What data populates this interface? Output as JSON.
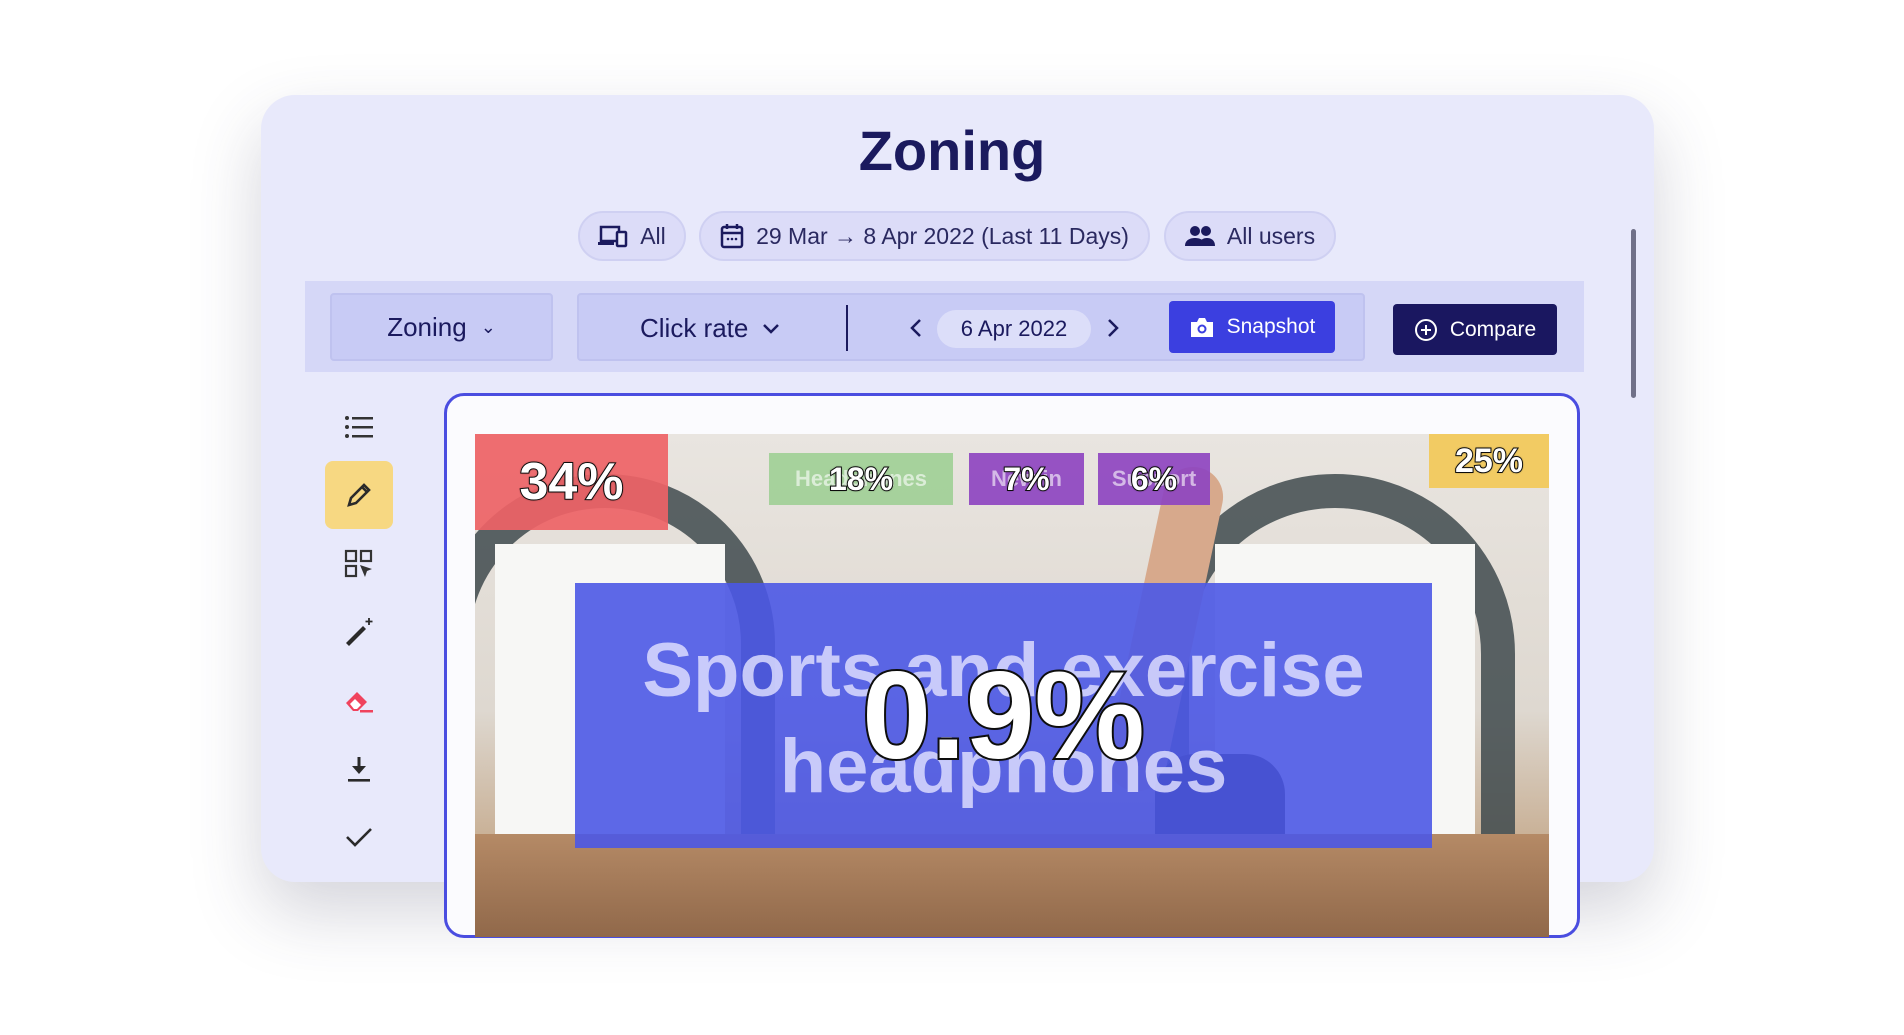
{
  "title": "Zoning",
  "filters": {
    "device": "All",
    "date_range": "29 Mar → 8 Apr 2022 (Last 11 Days)",
    "users": "All users"
  },
  "toolbar": {
    "view": "Zoning",
    "metric": "Click rate",
    "date": "6 Apr 2022",
    "snapshot": "Snapshot",
    "compare": "Compare"
  },
  "sidebar": [
    "list-icon",
    "pencil-icon",
    "zone-select-icon",
    "magic-wand-icon",
    "eraser-icon",
    "download-icon",
    "check-icon"
  ],
  "sidebar_active": "pencil-icon",
  "zones": [
    {
      "label": "",
      "value": "34%",
      "color": "#ee6a6c"
    },
    {
      "label": "Headphones",
      "value": "18%",
      "color": "#9fcf95"
    },
    {
      "label": "New in",
      "value": "7%",
      "color": "#8e45c0"
    },
    {
      "label": "Support",
      "value": "6%",
      "color": "#8e45c0"
    },
    {
      "label": "",
      "value": "25%",
      "color": "#f2c95c"
    },
    {
      "label": "Sports and exercise headphones",
      "value": "0.9%",
      "color": "#4b58e6"
    }
  ],
  "colors": {
    "accent": "#3b3fe0",
    "navy": "#1a1760",
    "frame": "#4a4de0"
  }
}
